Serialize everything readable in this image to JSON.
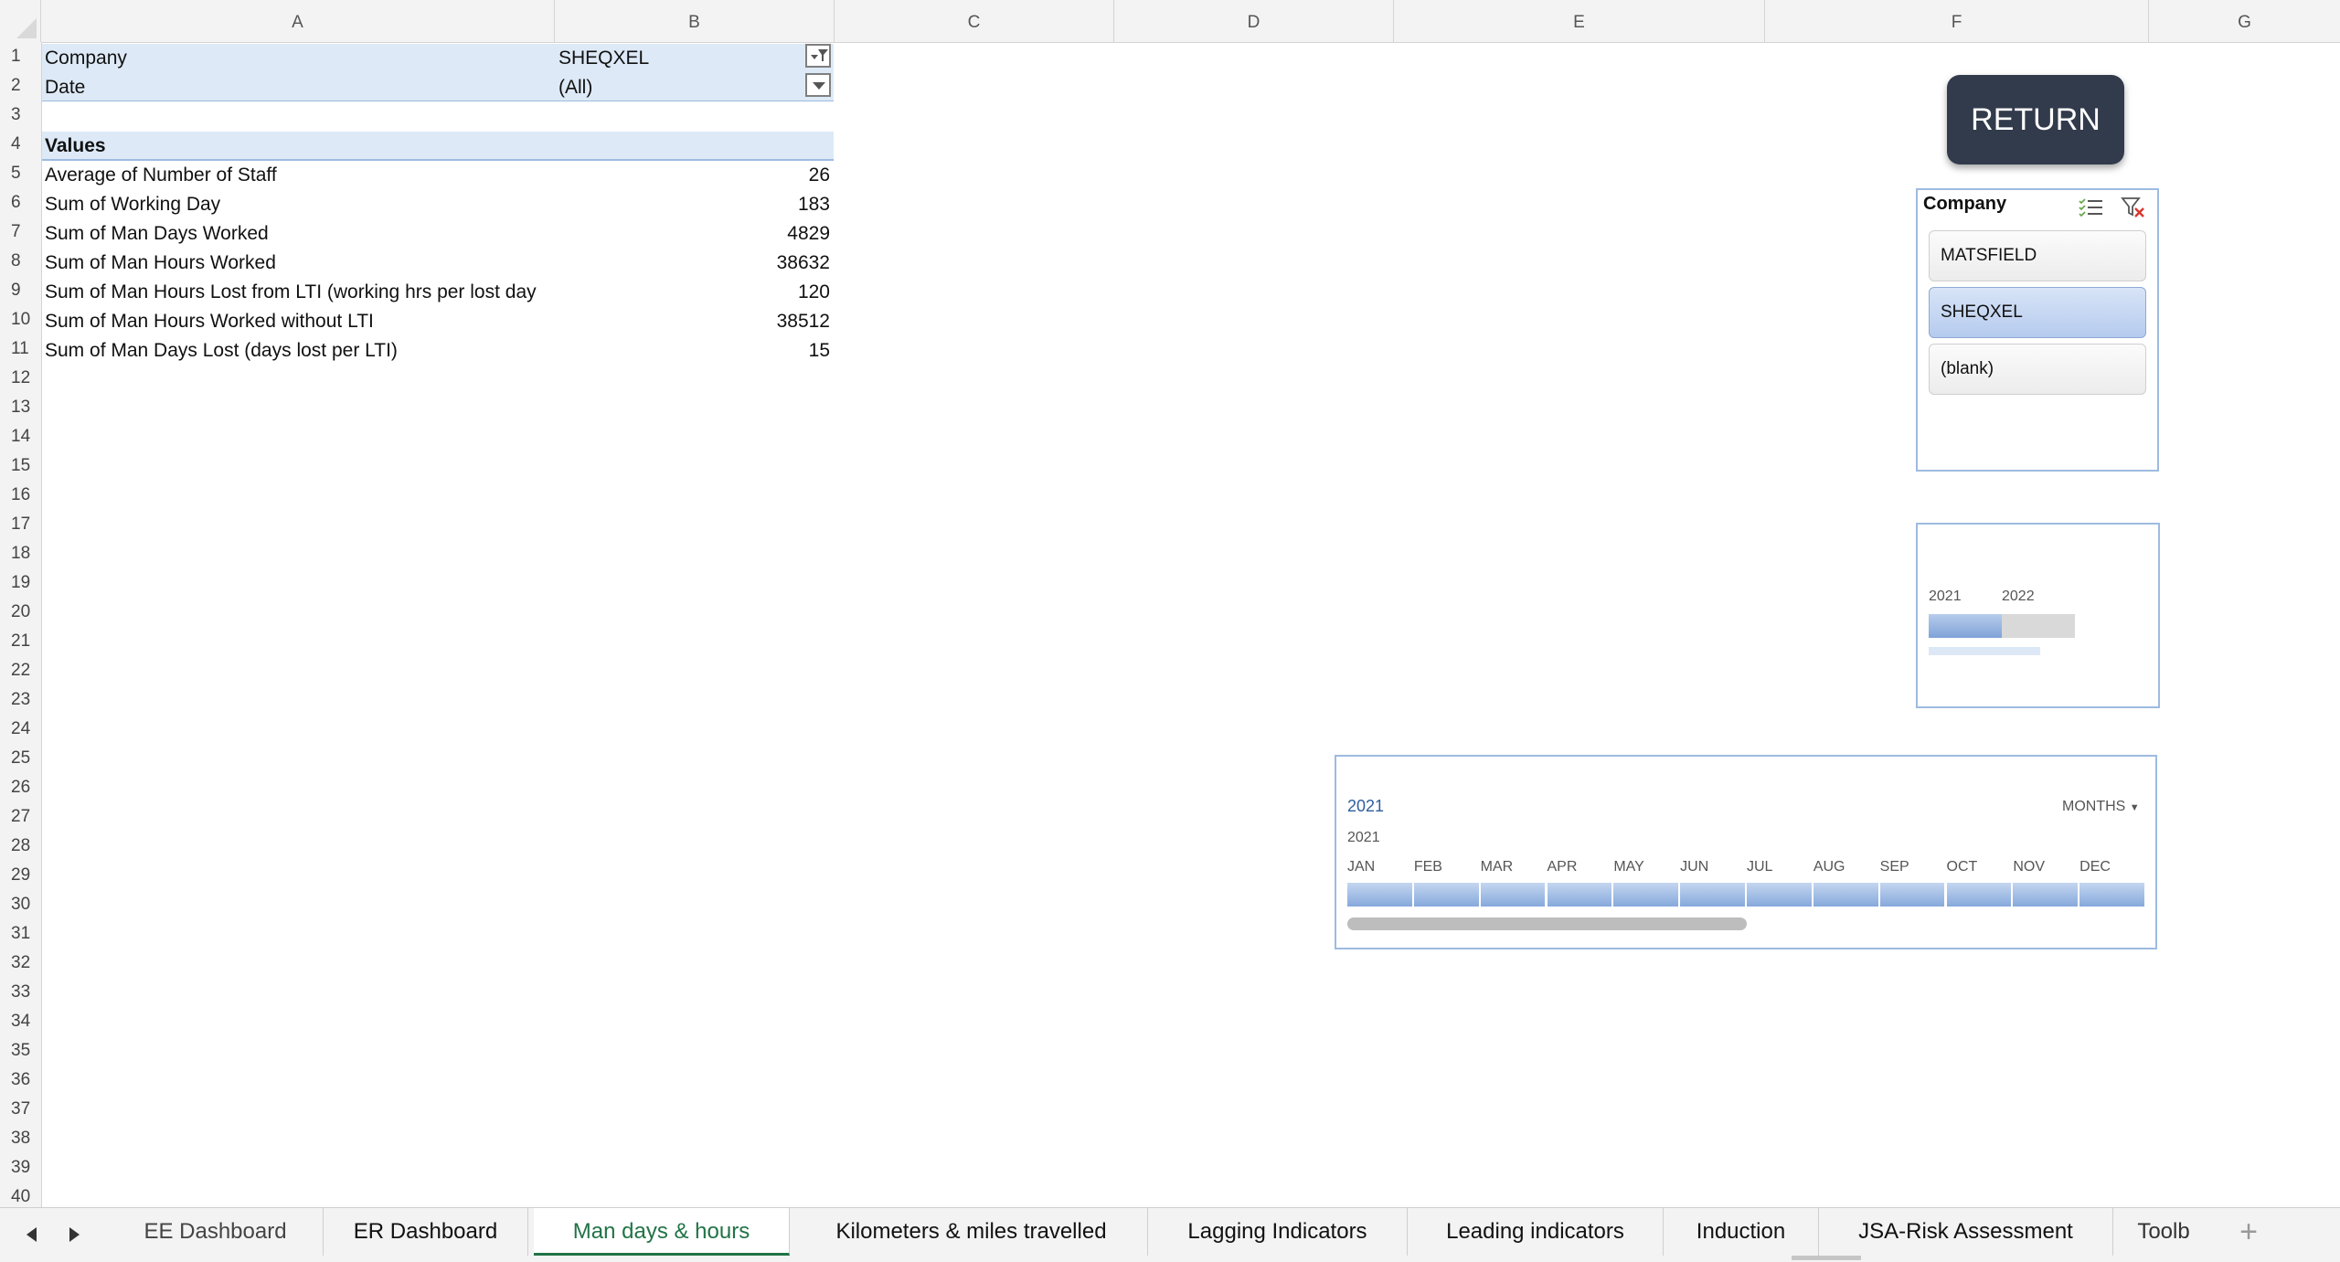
{
  "columns": [
    "A",
    "B",
    "C",
    "D",
    "E",
    "F",
    "G"
  ],
  "rows": [
    "1",
    "2",
    "3",
    "4",
    "5",
    "6",
    "7",
    "8",
    "9",
    "10",
    "11",
    "12",
    "13",
    "14",
    "15",
    "16",
    "17",
    "18",
    "19",
    "20",
    "21",
    "22",
    "23",
    "24",
    "25",
    "26",
    "27",
    "28",
    "29",
    "30",
    "31",
    "32",
    "33",
    "34",
    "35",
    "36",
    "37",
    "38",
    "39",
    "40"
  ],
  "pivot": {
    "filters": [
      {
        "label": "Company",
        "value": "SHEQXEL"
      },
      {
        "label": "Date",
        "value": "(All)"
      }
    ],
    "values_header": "Values",
    "items": [
      {
        "label": "Average of Number of Staff",
        "value": "26"
      },
      {
        "label": "Sum of Working Day",
        "value": "183"
      },
      {
        "label": "Sum of Man Days Worked",
        "value": "4829"
      },
      {
        "label": "Sum of Man Hours Worked",
        "value": "38632"
      },
      {
        "label": "Sum of Man Hours Lost from LTI (working hrs per lost day",
        "value": "120"
      },
      {
        "label": "Sum of Man Hours Worked without LTI",
        "value": "38512"
      },
      {
        "label": "Sum of Man Days Lost (days lost per LTI)",
        "value": "15"
      }
    ]
  },
  "return_button": {
    "label": "RETURN"
  },
  "company_slicer": {
    "title": "Company",
    "items": [
      {
        "label": "MATSFIELD",
        "selected": false
      },
      {
        "label": "SHEQXEL",
        "selected": true
      },
      {
        "label": "(blank)",
        "selected": false
      }
    ],
    "icons": [
      "multi-select-icon",
      "clear-filter-icon"
    ]
  },
  "year_timeline": {
    "years": [
      "2021",
      "2022"
    ],
    "selected_fraction": 0.5
  },
  "month_timeline": {
    "range_label": "2021",
    "level": "MONTHS",
    "year": "2021",
    "months": [
      "JAN",
      "FEB",
      "MAR",
      "APR",
      "MAY",
      "JUN",
      "JUL",
      "AUG",
      "SEP",
      "OCT",
      "NOV",
      "DEC"
    ],
    "scroll_fraction": 0.5
  },
  "tabs": [
    {
      "label": "EE Dashboard",
      "active": false
    },
    {
      "label": "ER Dashboard",
      "active": false
    },
    {
      "label": "Man days & hours",
      "active": true
    },
    {
      "label": "Kilometers & miles travelled",
      "active": false
    },
    {
      "label": "Lagging Indicators",
      "active": false
    },
    {
      "label": "Leading indicators",
      "active": false
    },
    {
      "label": "Induction",
      "active": false
    },
    {
      "label": "JSA-Risk Assessment",
      "active": false
    },
    {
      "label": "Toolb",
      "active": false
    }
  ],
  "tab_add": "+",
  "colors": {
    "accent": "#217346",
    "slicer_border": "#9dbbe0",
    "button": "#323b4c",
    "selection": "#b5cbee"
  }
}
